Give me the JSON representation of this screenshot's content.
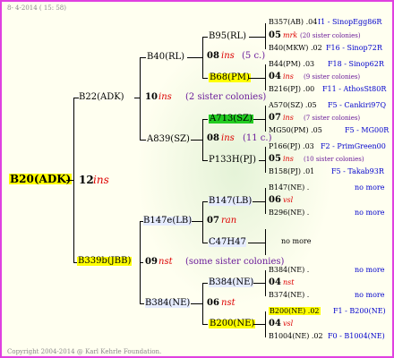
{
  "header": {
    "date": "8-  4-2014 ( 15: 58)"
  },
  "footer": {
    "copyright": "Copyright 2004-2014 @ Karl Kehrle Foundation."
  },
  "root": {
    "id": "B20(ADK)",
    "year": "12",
    "race": "ins"
  },
  "gen1": {
    "father": {
      "id": "B22(ADK)",
      "year": "10",
      "race": "ins",
      "note": "(2 sister colonies)"
    },
    "mother": {
      "id": "B339b(JBB)",
      "year": "09",
      "race": "nst",
      "note": "(some sister colonies)"
    }
  },
  "gen2": {
    "ff": {
      "id": "B40(RL)"
    },
    "fm": {
      "id": "A839(SZ)"
    },
    "mf": {
      "id": "B147e(LB)"
    },
    "mm": {
      "id": "B384(NE)"
    }
  },
  "gen3": {
    "fff": {
      "id": "B95(RL)",
      "year": "08",
      "race": "ins",
      "note": "(5 c.)"
    },
    "ffm": {
      "id": "B68(PM)"
    },
    "fmf": {
      "id": "A713(SZ)"
    },
    "fmf_row": {
      "year": "08",
      "race": "ins",
      "note": "(11 c.)"
    },
    "fmm": {
      "id": "P133H(PJ)"
    },
    "mff": {
      "id": "B147(LB)",
      "year": "07",
      "race": "ran"
    },
    "mfm": {
      "id": "C47H47"
    },
    "mmf": {
      "id": "B384(NE)",
      "year": "06",
      "race": "nst"
    },
    "mmm": {
      "id": "B200(NE)"
    }
  },
  "gen4": {
    "r1": {
      "text": "B357(AB) .04",
      "extra": "I1 - SinopEgg86R"
    },
    "r2": {
      "year": "05",
      "race": "mrk",
      "note": "(20 sister colonies)"
    },
    "r3": {
      "text": "B40(MKW) .02",
      "extra": "F16 - Sinop72R"
    },
    "r4": {
      "text": "B44(PM) .03",
      "extra": "F18 - Sinop62R"
    },
    "r5": {
      "year": "04",
      "race": "ins",
      "note": "(9 sister colonies)"
    },
    "r6": {
      "text": "B216(PJ) .00",
      "extra": "F11 - AthosSt80R"
    },
    "r7": {
      "text": "A570(SZ) .05",
      "extra": "F5 - Cankiri97Q"
    },
    "r8": {
      "year": "07",
      "race": "ins",
      "note": "(7 sister colonies)"
    },
    "r9": {
      "text": "MG50(PM) .05",
      "extra": "F5 - MG00R"
    },
    "r10": {
      "text": "P166(PJ) .03",
      "extra": "F2 - PrimGreen00"
    },
    "r11": {
      "year": "05",
      "race": "ins",
      "note": "(10 sister colonies)"
    },
    "r12": {
      "text": "B158(PJ) .01",
      "extra": "F5 - Takab93R"
    },
    "r13": {
      "text": "B147(NE) .",
      "extra": "no more"
    },
    "r14": {
      "year": "06",
      "race": "vsl"
    },
    "r15": {
      "text": "B296(NE) .",
      "extra": "no more"
    },
    "r16": {
      "text": "no more"
    },
    "r17": {
      "text": "B384(NE) .",
      "extra": "no more"
    },
    "r18": {
      "year": "04",
      "race": "nst"
    },
    "r19": {
      "text": "B374(NE) .",
      "extra": "no more"
    },
    "r20": {
      "text": "B200(NE) .02",
      "extra": "F1 - B200(NE)"
    },
    "r21": {
      "year": "04",
      "race": "vsl"
    },
    "r22": {
      "text": "B1004(NE) .02",
      "extra": "F0 - B1004(NE)"
    }
  }
}
